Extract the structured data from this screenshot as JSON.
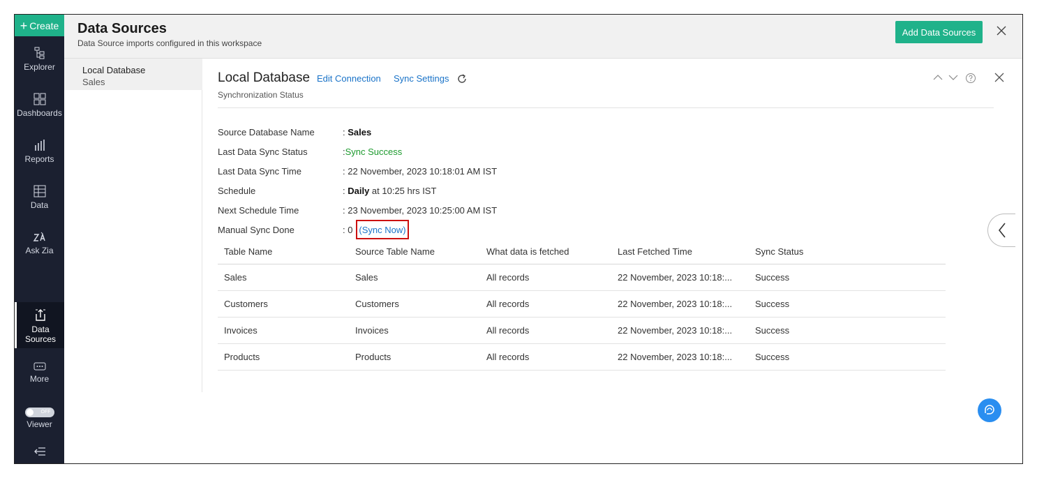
{
  "nav": {
    "create_label": "Create",
    "items": [
      {
        "label": "Explorer",
        "icon": "explorer-tree-icon"
      },
      {
        "label": "Dashboards",
        "icon": "dashboards-grid-icon"
      },
      {
        "label": "Reports",
        "icon": "reports-bars-icon"
      },
      {
        "label": "Data",
        "icon": "data-table-icon"
      },
      {
        "label": "Ask Zia",
        "icon": "ask-zia-icon"
      },
      {
        "label": "Data\nSources",
        "icon": "data-sources-icon",
        "active": true
      },
      {
        "label": "More",
        "icon": "more-icon"
      },
      {
        "label": "Viewer",
        "icon": "viewer-toggle-icon",
        "toggle_text": "OFF"
      }
    ]
  },
  "header": {
    "title": "Data Sources",
    "subtitle": "Data Source imports configured in this workspace",
    "add_button": "Add Data Sources"
  },
  "source_list": [
    {
      "name": "Local Database",
      "sub": "Sales"
    }
  ],
  "detail": {
    "title": "Local Database",
    "edit_connection": "Edit Connection",
    "sync_settings": "Sync Settings",
    "subtitle": "Synchronization Status",
    "info": {
      "db_name_label": "Source Database Name",
      "db_name_value": "Sales",
      "sync_status_label": "Last Data Sync Status",
      "sync_status_value": "Sync Success",
      "sync_time_label": "Last Data Sync Time",
      "sync_time_value": ": 22 November, 2023 10:18:01 AM IST",
      "schedule_label": "Schedule",
      "schedule_bold": "Daily",
      "schedule_rest": " at 10:25 hrs IST",
      "next_label": "Next Schedule Time",
      "next_value": ": 23 November, 2023 10:25:00 AM IST",
      "manual_label": "Manual Sync Done",
      "manual_value": ": 0",
      "sync_now": "(Sync Now)"
    },
    "table": {
      "headers": [
        "Table Name",
        "Source Table Name",
        "What data is fetched",
        "Last Fetched Time",
        "Sync Status"
      ],
      "rows": [
        [
          "Sales",
          "Sales",
          "All records",
          "22 November, 2023 10:18:...",
          "Success"
        ],
        [
          "Customers",
          "Customers",
          "All records",
          "22 November, 2023 10:18:...",
          "Success"
        ],
        [
          "Invoices",
          "Invoices",
          "All records",
          "22 November, 2023 10:18:...",
          "Success"
        ],
        [
          "Products",
          "Products",
          "All records",
          "22 November, 2023 10:18:...",
          "Success"
        ]
      ]
    }
  },
  "colors": {
    "accent": "#1fb28a",
    "nav_bg": "#1b2030",
    "link": "#1a73c8",
    "success": "#1d9a2e",
    "highlight": "#cc1010"
  }
}
